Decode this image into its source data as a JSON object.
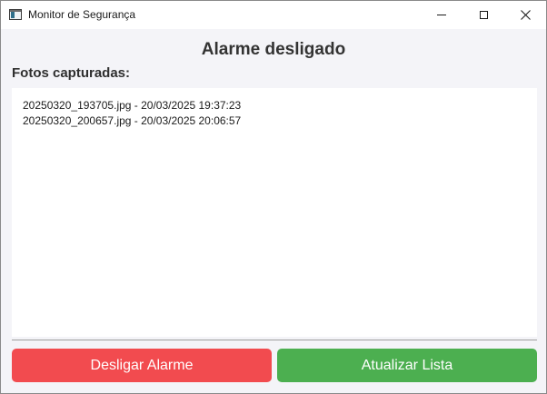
{
  "window": {
    "title": "Monitor de Segurança",
    "controls": {
      "minimize_icon": "minimize-icon",
      "maximize_icon": "maximize-icon",
      "close_icon": "close-icon",
      "close_glyph": "✕"
    }
  },
  "main": {
    "status": "Alarme desligado",
    "photos_label": "Fotos capturadas:",
    "photos": [
      "20250320_193705.jpg - 20/03/2025 19:37:23",
      "20250320_200657.jpg - 20/03/2025 20:06:57"
    ]
  },
  "actions": {
    "disable_alarm": "Desligar Alarme",
    "refresh_list": "Atualizar Lista"
  },
  "colors": {
    "disable_alarm_bg": "#f24b4f",
    "refresh_list_bg": "#4caf50",
    "background": "#f4f4f8",
    "list_background": "#ffffff"
  }
}
